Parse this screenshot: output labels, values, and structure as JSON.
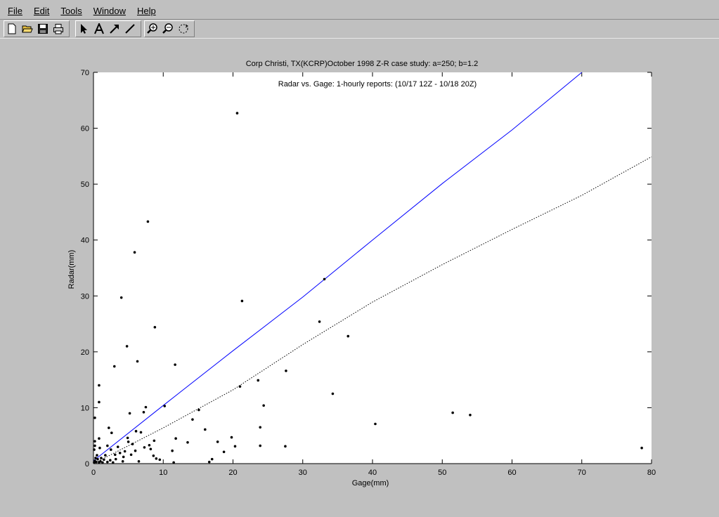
{
  "menu": {
    "items": [
      {
        "label": "File"
      },
      {
        "label": "Edit"
      },
      {
        "label": "Tools"
      },
      {
        "label": "Window"
      },
      {
        "label": "Help"
      }
    ]
  },
  "toolbar": {
    "icons": [
      "new-file-icon",
      "open-folder-icon",
      "save-icon",
      "print-icon",
      "select-arrow-icon",
      "text-icon",
      "arrow-icon",
      "line-icon",
      "zoom-in-icon",
      "zoom-out-icon",
      "rotate-icon"
    ]
  },
  "chart_data": {
    "type": "scatter",
    "title": "Corp Christi, TX(KCRP)October 1998 Z-R case study: a=250; b=1.2",
    "subtitle": "Radar vs. Gage: 1-hourly reports: (10/17 12Z - 10/18 20Z)",
    "xlabel": "Gage(mm)",
    "ylabel": "Radar(mm)",
    "xlim": [
      0,
      80
    ],
    "ylim": [
      0,
      70
    ],
    "xticks": [
      0,
      10,
      20,
      30,
      40,
      50,
      60,
      70,
      80
    ],
    "yticks": [
      0,
      10,
      20,
      30,
      40,
      50,
      60,
      70
    ],
    "grid": false,
    "point_color": "#000000",
    "series": [
      {
        "style": "points",
        "points": [
          [
            0.1,
            0.2
          ],
          [
            0.2,
            0.5
          ],
          [
            0.3,
            1.0
          ],
          [
            0.1,
            2.5
          ],
          [
            0.2,
            3.2
          ],
          [
            0.2,
            4.0
          ],
          [
            0.2,
            8.2
          ],
          [
            0.4,
            0.3
          ],
          [
            0.5,
            1.5
          ],
          [
            0.6,
            0.8
          ],
          [
            0.8,
            0.2
          ],
          [
            0.9,
            2.8
          ],
          [
            0.8,
            4.5
          ],
          [
            0.8,
            11.0
          ],
          [
            0.8,
            14.0
          ],
          [
            1.0,
            0.4
          ],
          [
            1.1,
            1.0
          ],
          [
            1.3,
            0.2
          ],
          [
            1.5,
            0.7
          ],
          [
            1.7,
            1.5
          ],
          [
            2.0,
            0.3
          ],
          [
            2.0,
            3.2
          ],
          [
            2.2,
            6.4
          ],
          [
            2.4,
            0.6
          ],
          [
            2.5,
            2.5
          ],
          [
            2.6,
            5.5
          ],
          [
            2.8,
            0.2
          ],
          [
            3.0,
            17.4
          ],
          [
            3.1,
            1.6
          ],
          [
            3.2,
            0.8
          ],
          [
            3.5,
            3.0
          ],
          [
            3.8,
            1.9
          ],
          [
            4.0,
            29.7
          ],
          [
            4.2,
            0.4
          ],
          [
            4.3,
            1.2
          ],
          [
            4.5,
            2.2
          ],
          [
            4.8,
            21.0
          ],
          [
            4.9,
            4.6
          ],
          [
            5.0,
            3.9
          ],
          [
            5.2,
            9.0
          ],
          [
            5.4,
            1.6
          ],
          [
            5.6,
            3.5
          ],
          [
            5.9,
            37.8
          ],
          [
            6.0,
            2.3
          ],
          [
            6.1,
            5.8
          ],
          [
            6.3,
            18.3
          ],
          [
            6.5,
            0.4
          ],
          [
            6.8,
            5.6
          ],
          [
            7.2,
            9.2
          ],
          [
            7.3,
            2.9
          ],
          [
            7.5,
            10.1
          ],
          [
            7.8,
            43.3
          ],
          [
            8.0,
            3.3
          ],
          [
            8.2,
            2.6
          ],
          [
            8.6,
            1.4
          ],
          [
            8.7,
            4.1
          ],
          [
            8.8,
            24.4
          ],
          [
            9.0,
            0.9
          ],
          [
            9.5,
            0.7
          ],
          [
            10.2,
            10.3
          ],
          [
            11.3,
            2.3
          ],
          [
            11.5,
            0.2
          ],
          [
            11.7,
            17.7
          ],
          [
            11.8,
            4.5
          ],
          [
            13.5,
            3.8
          ],
          [
            14.2,
            7.9
          ],
          [
            15.1,
            9.6
          ],
          [
            16.0,
            6.1
          ],
          [
            16.6,
            0.3
          ],
          [
            17.0,
            0.8
          ],
          [
            17.8,
            3.9
          ],
          [
            18.7,
            2.1
          ],
          [
            19.8,
            4.7
          ],
          [
            20.3,
            3.1
          ],
          [
            20.6,
            62.7
          ],
          [
            21.0,
            13.8
          ],
          [
            21.3,
            29.1
          ],
          [
            23.6,
            14.9
          ],
          [
            23.9,
            3.2
          ],
          [
            23.9,
            6.5
          ],
          [
            24.4,
            10.4
          ],
          [
            27.5,
            3.1
          ],
          [
            27.6,
            16.6
          ],
          [
            32.4,
            25.4
          ],
          [
            33.1,
            33.0
          ],
          [
            34.3,
            12.5
          ],
          [
            36.5,
            22.8
          ],
          [
            40.4,
            7.1
          ],
          [
            51.5,
            9.1
          ],
          [
            54.0,
            8.7
          ],
          [
            78.6,
            2.8
          ]
        ]
      },
      {
        "style": "solid-line",
        "color": "#0000ff",
        "points": [
          [
            0,
            0.5
          ],
          [
            10,
            10.4
          ],
          [
            20,
            20.2
          ],
          [
            30,
            29.8
          ],
          [
            40,
            40.0
          ],
          [
            50,
            50.1
          ],
          [
            60,
            59.7
          ],
          [
            70,
            70.0
          ]
        ]
      },
      {
        "style": "dotted-line",
        "color": "#000000",
        "points": [
          [
            0,
            0
          ],
          [
            10,
            6.4
          ],
          [
            20,
            13.2
          ],
          [
            30,
            21.3
          ],
          [
            40,
            28.9
          ],
          [
            50,
            35.6
          ],
          [
            60,
            41.9
          ],
          [
            70,
            48.0
          ],
          [
            80,
            54.9
          ]
        ]
      }
    ]
  }
}
